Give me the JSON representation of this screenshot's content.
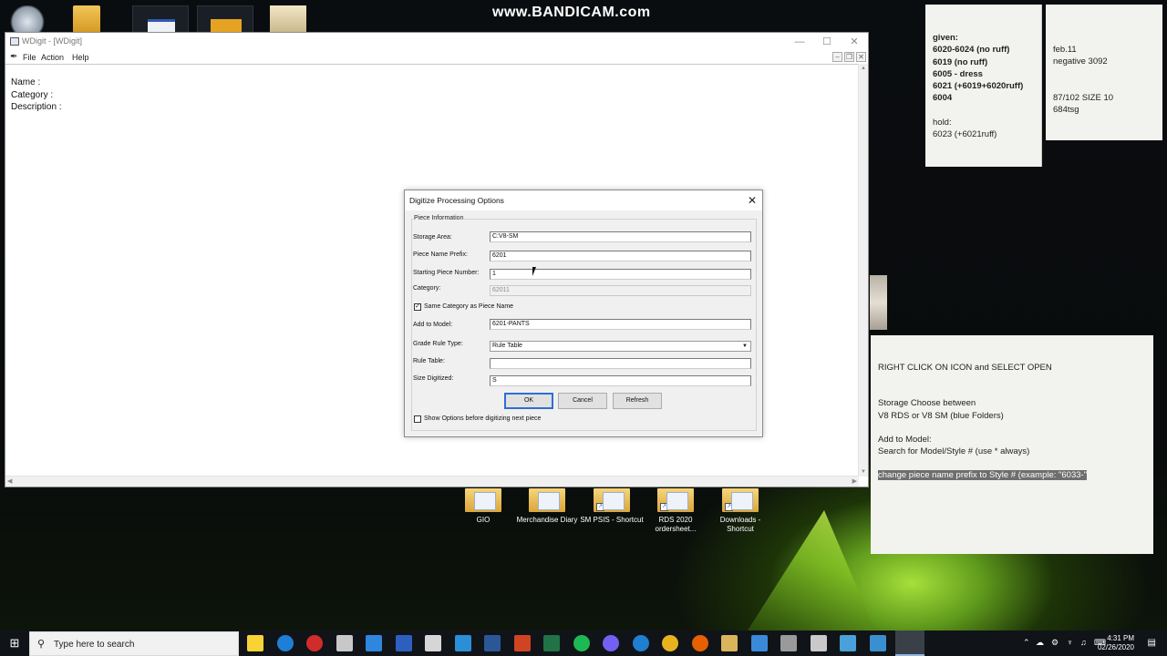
{
  "watermark": "www.BANDICAM.com",
  "window": {
    "title": "WDigit - [WDigit]",
    "menu": {
      "file": "File",
      "action": "Action",
      "help": "Help"
    },
    "info": {
      "name_label": "Name :",
      "category_label": "Category :",
      "description_label": "Description :"
    }
  },
  "dialog": {
    "title": "Digitize Processing Options",
    "group_label": "Piece Information",
    "fields": {
      "storage_area": {
        "label": "Storage Area:",
        "value": "C:V8-SM"
      },
      "piece_name_prefix": {
        "label": "Piece Name Prefix:",
        "value": "6201"
      },
      "starting_piece_number": {
        "label": "Starting Piece Number:",
        "value": "1"
      },
      "category": {
        "label": "Category:",
        "value": "62011"
      },
      "same_category_checkbox": {
        "label": "Same Category as Piece Name",
        "checked": true
      },
      "add_to_model": {
        "label": "Add to Model:",
        "value": "6201-PANTS"
      },
      "grade_rule_type": {
        "label": "Grade Rule Type:",
        "value": "Rule Table"
      },
      "rule_table": {
        "label": "Rule Table:",
        "value": ""
      },
      "size_digitized": {
        "label": "Size Digitized:",
        "value": "S"
      }
    },
    "buttons": {
      "ok": "OK",
      "cancel": "Cancel",
      "refresh": "Refresh"
    },
    "show_options_checkbox": {
      "label": "Show Options before digitizing next piece",
      "checked": false
    }
  },
  "notes": {
    "note1": {
      "heading": "given:",
      "bold_lines": [
        "6020-6024 (no ruff)",
        "6019 (no ruff)",
        "6005 - dress",
        "6021 (+6019+6020ruff)",
        "6004"
      ],
      "hold_heading": "hold:",
      "hold_line": "6023 (+6021ruff)"
    },
    "note2": {
      "line1": "feb.11",
      "line2": "negative 3092",
      "line3": "87/102 SIZE 10",
      "line4": "684tsg"
    },
    "note3": {
      "line1": "RIGHT CLICK ON ICON and SELECT OPEN",
      "line2": "Storage Choose between",
      "line3": "V8 RDS or V8 SM (blue Folders)",
      "line4": "Add to Model:",
      "line5": "Search for Model/Style # (use * always)",
      "highlight": "change piece name prefix to Style # (example: \"6033-\""
    }
  },
  "desktop_icons": [
    {
      "label1": "GIO",
      "label2": ""
    },
    {
      "label1": "Merchandise Diary",
      "label2": ""
    },
    {
      "label1": "SM PSIS - Shortcut",
      "label2": ""
    },
    {
      "label1": "RDS 2020",
      "label2": "ordersheet..."
    },
    {
      "label1": "Downloads -",
      "label2": "Shortcut"
    }
  ],
  "taskbar": {
    "search_placeholder": "Type here to search",
    "time": "4:31 PM",
    "date": "02/26/2020"
  },
  "colors": {
    "accent_blue": "#2f6fd2",
    "note_bg": "#f2f3ee",
    "taskbar_bg": "#101418"
  }
}
